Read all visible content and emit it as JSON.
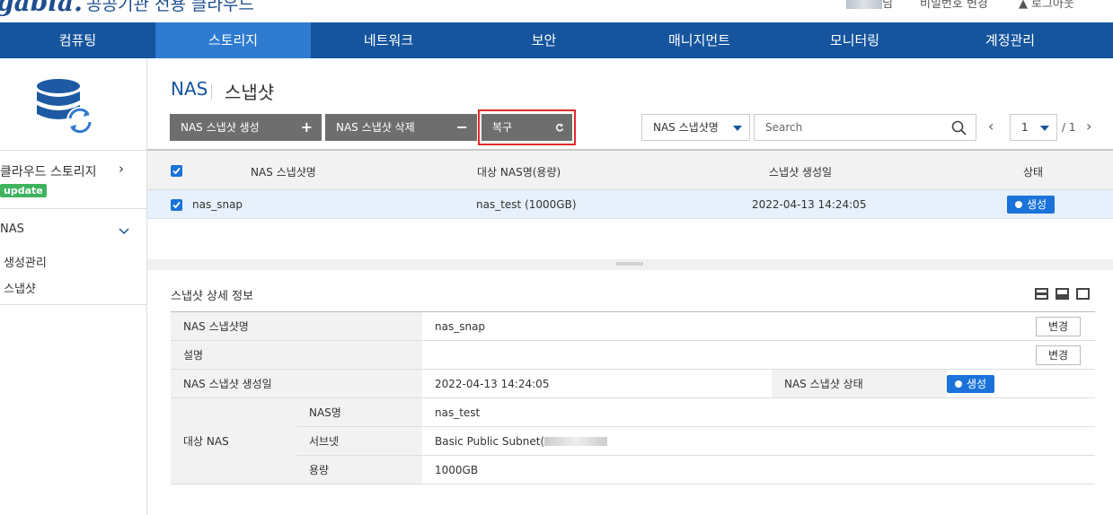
{
  "brand": {
    "logo": "gabia.",
    "subtitle": "공공기관 전용 클라우드"
  },
  "top_util": {
    "user_suffix": "님",
    "password_change": "비밀번호 변경",
    "logout": "로그아웃"
  },
  "gnb": {
    "items": [
      "컴퓨팅",
      "스토리지",
      "네트워크",
      "보안",
      "매니지먼트",
      "모니터링",
      "계정관리"
    ],
    "active_index": 1
  },
  "sidebar": {
    "cloud_storage": "클라우드 스토리지",
    "update_badge": "update",
    "nas": "NAS",
    "items": [
      "생성관리",
      "스냅샷"
    ]
  },
  "page": {
    "title": "NAS",
    "subtitle": "스냅샷"
  },
  "toolbar": {
    "create_label": "NAS 스냅샷 생성",
    "delete_label": "NAS 스냅샷 삭제",
    "restore_label": "복구",
    "filter_value": "NAS 스냅샷명",
    "search_placeholder": "Search",
    "page_current": "1",
    "page_total": "/ 1"
  },
  "grid": {
    "headers": [
      "NAS 스냅샷명",
      "대상 NAS명(용량)",
      "스냅샷 생성일",
      "상태"
    ],
    "rows": [
      {
        "name": "nas_snap",
        "target": "nas_test (1000GB)",
        "created": "2022-04-13 14:24:05",
        "status": "생성"
      }
    ]
  },
  "detail": {
    "title": "스냅샷 상세 정보",
    "edit_label": "변경",
    "snapshot_name_label": "NAS 스냅샷명",
    "snapshot_name": "nas_snap",
    "description_label": "설명",
    "description": "",
    "created_label": "NAS 스냅샷 생성일",
    "created": "2022-04-13 14:24:05",
    "status_label": "NAS 스냅샷 상태",
    "status": "생성",
    "target_nas_label": "대상 NAS",
    "nas_name_label": "NAS명",
    "nas_name": "nas_test",
    "subnet_label": "서브넷",
    "subnet": "Basic Public Subnet(",
    "capacity_label": "용량",
    "capacity": "1000GB"
  },
  "colors": {
    "header_blue": "#16559e",
    "active_tab": "#2f7bd0",
    "badge_blue": "#1a73d9",
    "highlight_red": "#e02a2a",
    "update_green": "#3fb35f"
  }
}
